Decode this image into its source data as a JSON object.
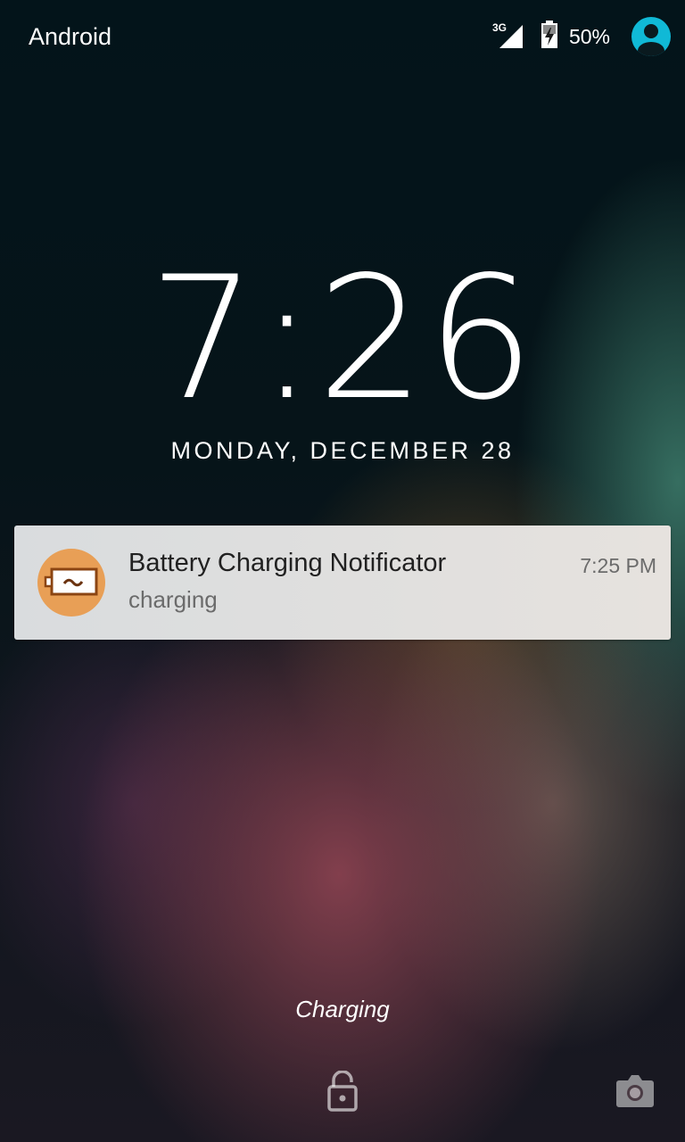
{
  "status_bar": {
    "carrier": "Android",
    "network_type": "3G",
    "battery_percent": "50%",
    "icons": [
      "signal-icon",
      "battery-charging-icon",
      "user-avatar-icon"
    ],
    "avatar_color": "#10b9d6"
  },
  "lockscreen": {
    "time": "7:26",
    "date": "MONDAY, DECEMBER 28",
    "status": "Charging"
  },
  "notification": {
    "title": "Battery Charging Notificator",
    "text": "charging",
    "time": "7:25 PM",
    "icon": "battery-charge-icon",
    "icon_color": "#e89f56"
  },
  "bottom_actions": {
    "icons": [
      "unlock-icon",
      "camera-icon"
    ]
  }
}
